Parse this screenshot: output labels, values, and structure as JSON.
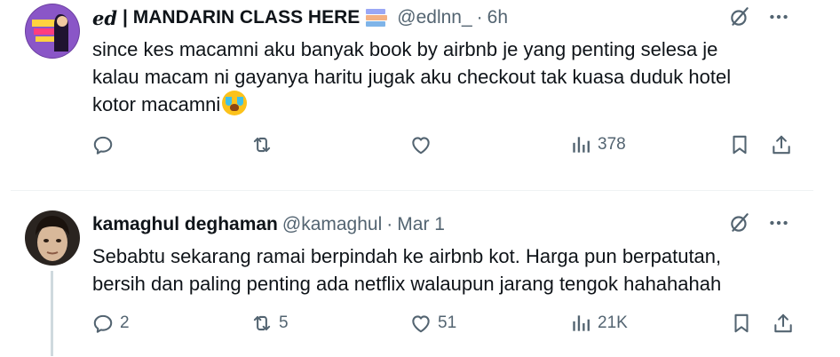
{
  "tweets": [
    {
      "name_styled": "ed",
      "name": "| MANDARIN CLASS HERE",
      "handle": "@edlnn_",
      "separator": "·",
      "time": "6h",
      "text_lines": [
        "since kes macamni aku banyak book by airbnb je yang penting selesa je",
        "kalau macam ni gayanya haritu jugak aku checkout tak kuasa duduk hotel",
        "kotor macamni"
      ],
      "emoji": "loudly-crying-face",
      "views": "378",
      "replies": "",
      "reposts": "",
      "likes": ""
    },
    {
      "name": "kamaghul deghaman",
      "handle": "@kamaghul",
      "separator": "·",
      "time": "Mar 1",
      "text_lines": [
        "Sebabtu sekarang ramai berpindah ke airbnb kot. Harga pun berpatutan,",
        "bersih dan paling penting ada netflix walaupun jarang tengok hahahahah"
      ],
      "replies": "2",
      "reposts": "5",
      "likes": "51",
      "views": "21K"
    }
  ],
  "icons": [
    "grok-icon",
    "more-icon",
    "reply-icon",
    "repost-icon",
    "like-icon",
    "views-icon",
    "bookmark-icon",
    "share-icon"
  ],
  "colors": {
    "text": "#0f1419",
    "muted": "#536471",
    "divider": "#eff3f4",
    "thread": "#cfd9de"
  }
}
